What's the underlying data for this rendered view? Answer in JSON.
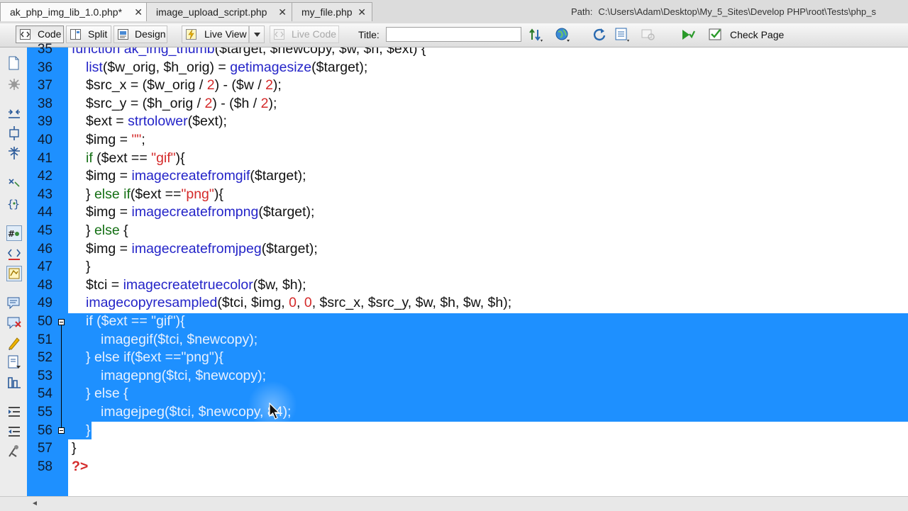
{
  "tabs": [
    {
      "label": "ak_php_img_lib_1.0.php*",
      "active": true
    },
    {
      "label": "image_upload_script.php",
      "active": false
    },
    {
      "label": "my_file.php",
      "active": false
    }
  ],
  "path": {
    "label": "Path:",
    "value": "C:\\Users\\Adam\\Desktop\\My_5_Sites\\Develop PHP\\root\\Tests\\php_s"
  },
  "toolbar": {
    "code": "Code",
    "split": "Split",
    "design": "Design",
    "live_view": "Live View",
    "live_code": "Live Code",
    "title_label": "Title:",
    "title_value": "",
    "check_page": "Check Page"
  },
  "editor": {
    "first_line": 35,
    "selected_range": [
      50,
      56
    ],
    "lines": [
      {
        "n": "35",
        "text": "function ak_img_thumb($target, $newcopy, $w, $h, $ext) {"
      },
      {
        "n": "36",
        "text": "list($w_orig, $h_orig) = getimagesize($target);"
      },
      {
        "n": "37",
        "text": "$src_x = ($w_orig / 2) - ($w / 2);"
      },
      {
        "n": "38",
        "text": "$src_y = ($h_orig / 2) - ($h / 2);"
      },
      {
        "n": "39",
        "text": "$ext = strtolower($ext);"
      },
      {
        "n": "40",
        "text": "$img = \"\";"
      },
      {
        "n": "41",
        "text": "if ($ext == \"gif\"){"
      },
      {
        "n": "42",
        "text": "$img = imagecreatefromgif($target);"
      },
      {
        "n": "43",
        "text": "} else if($ext ==\"png\"){"
      },
      {
        "n": "44",
        "text": "$img = imagecreatefrompng($target);"
      },
      {
        "n": "45",
        "text": "} else {"
      },
      {
        "n": "46",
        "text": "$img = imagecreatefromjpeg($target);"
      },
      {
        "n": "47",
        "text": "}"
      },
      {
        "n": "48",
        "text": "$tci = imagecreatetruecolor($w, $h);"
      },
      {
        "n": "49",
        "text": "imagecopyresampled($tci, $img, 0, 0, $src_x, $src_y, $w, $h, $w, $h);"
      },
      {
        "n": "50",
        "text": "if ($ext == \"gif\"){"
      },
      {
        "n": "51",
        "text": "imagegif($tci, $newcopy);"
      },
      {
        "n": "52",
        "text": "} else if($ext ==\"png\"){"
      },
      {
        "n": "53",
        "text": "imagepng($tci, $newcopy);"
      },
      {
        "n": "54",
        "text": "} else {"
      },
      {
        "n": "55",
        "text": "imagejpeg($tci, $newcopy, 84);"
      },
      {
        "n": "56",
        "text": "}"
      },
      {
        "n": "57",
        "text": "}"
      },
      {
        "n": "58",
        "text": "?>"
      }
    ]
  },
  "colors": {
    "gutter": "#1e90ff",
    "selection": "#1e90ff",
    "function": "#2424c8",
    "keyword": "#157015",
    "string_number": "#d42a2a"
  }
}
